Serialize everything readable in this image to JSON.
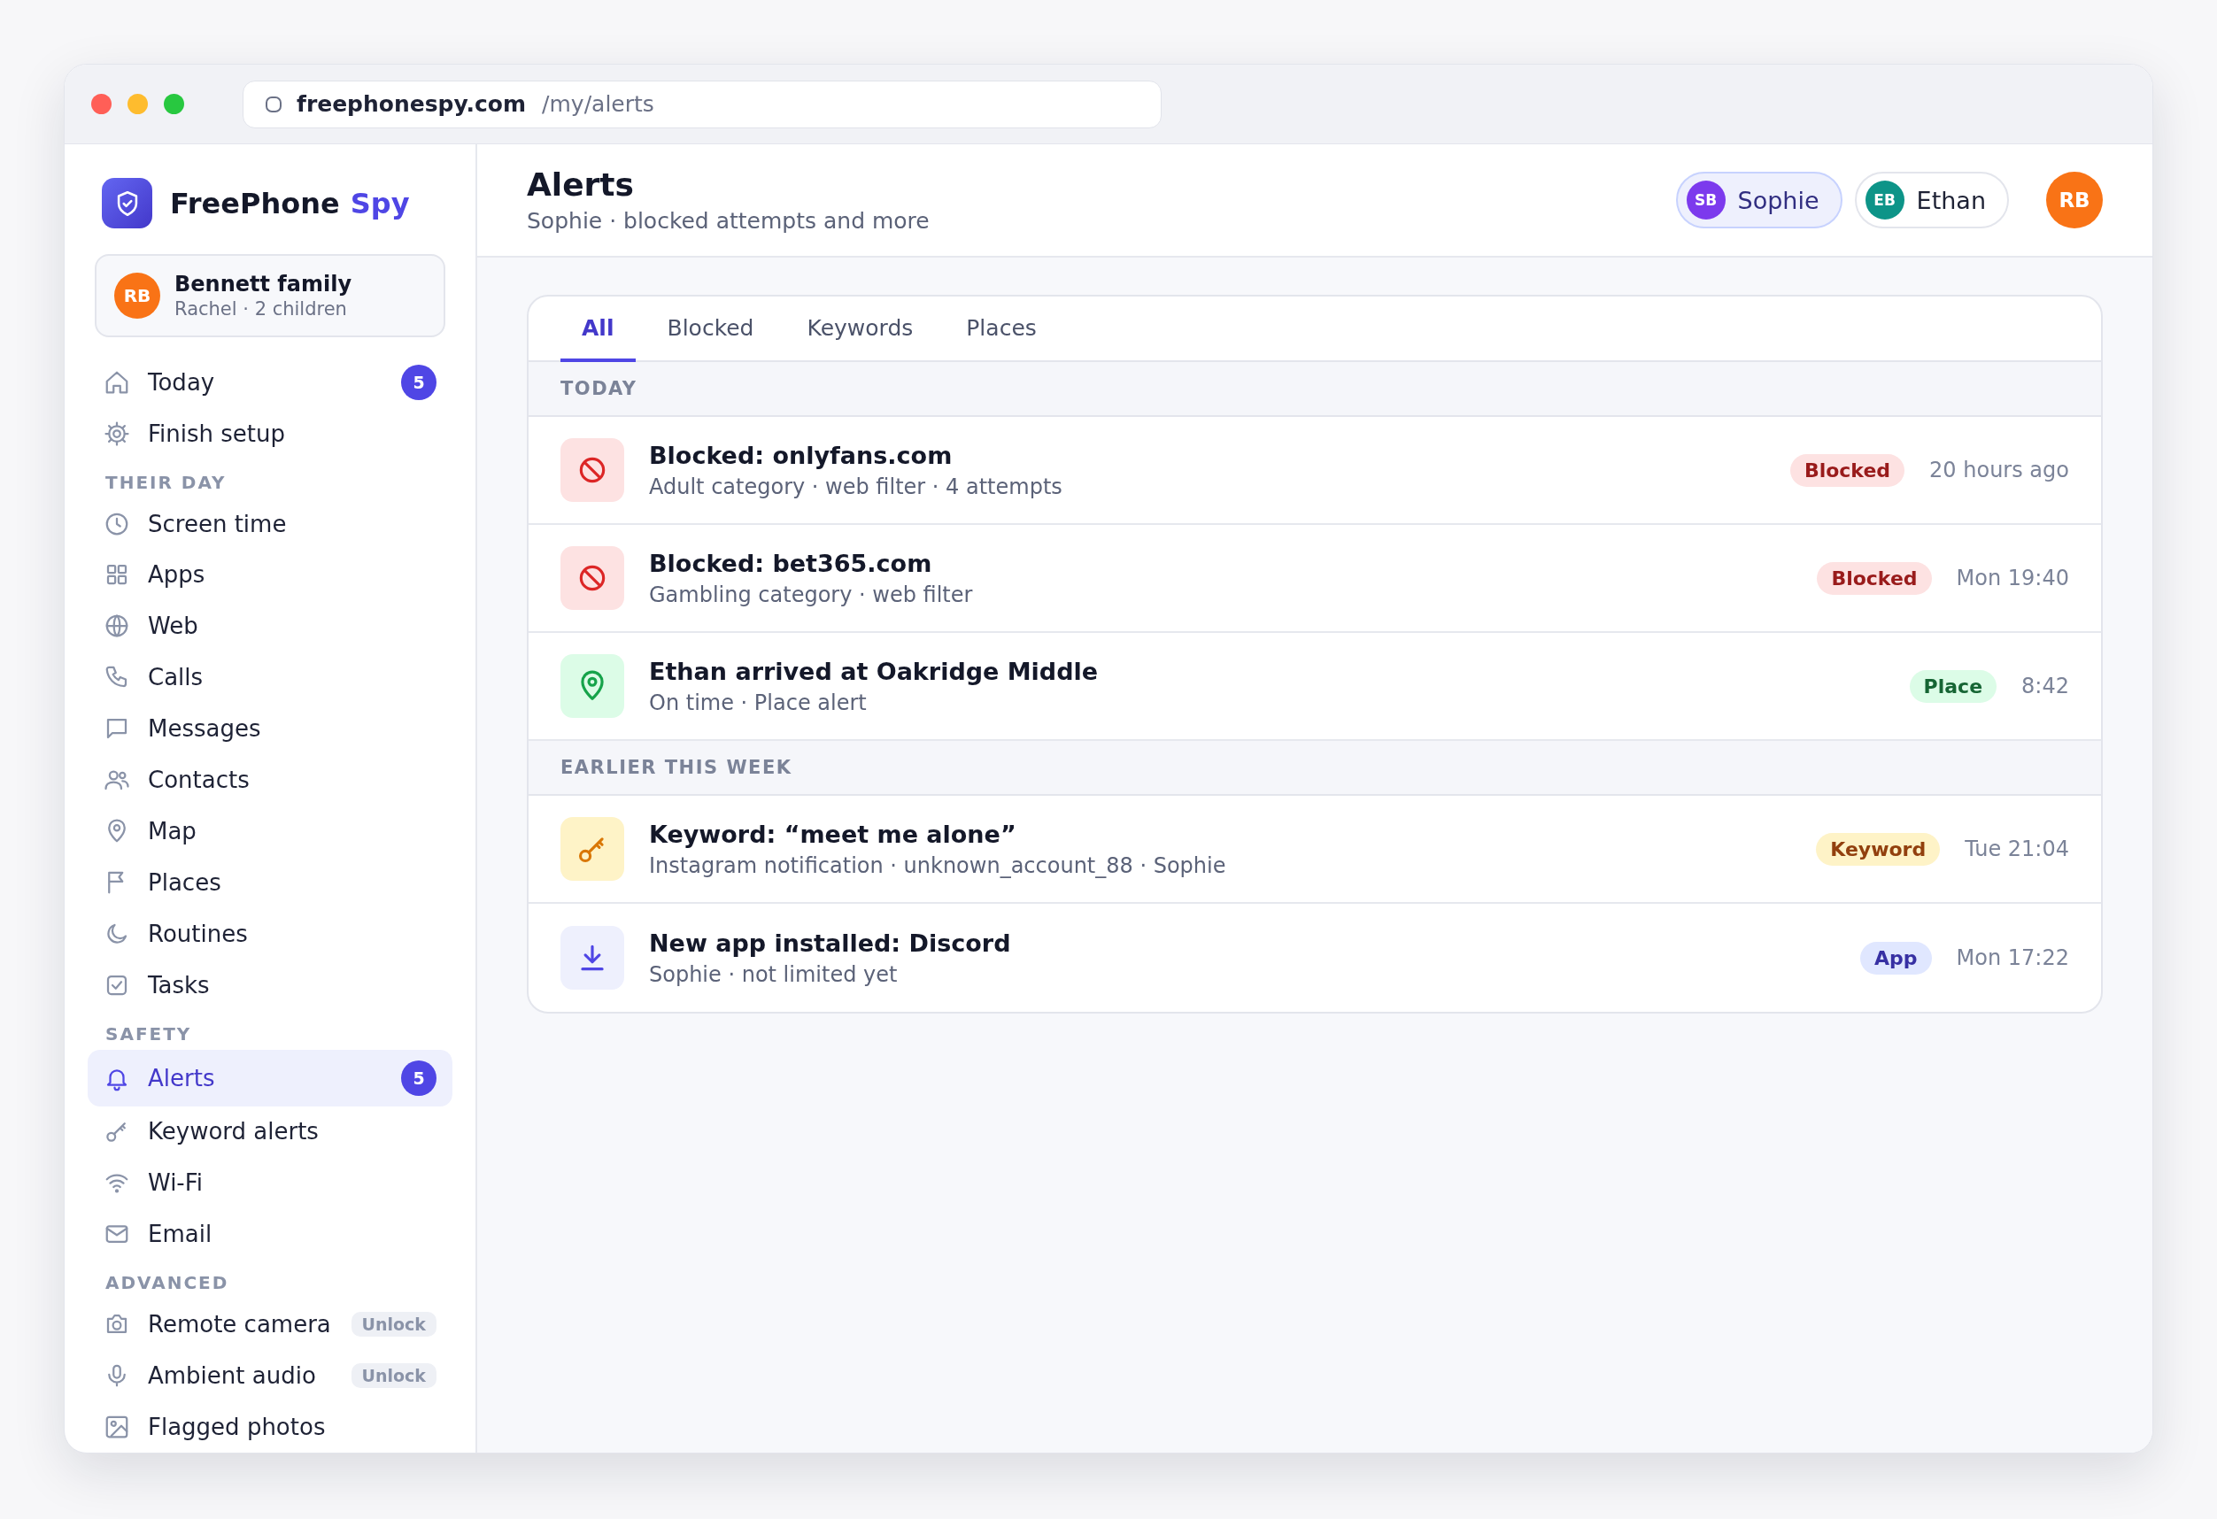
{
  "browser": {
    "domain": "freephonespy.com",
    "path": "/my/alerts"
  },
  "sidebar": {
    "brand": {
      "name": "FreePhone",
      "accent": "Spy"
    },
    "account": {
      "initials": "RB",
      "name": "Bennett family",
      "subtitle": "Rachel · 2 children",
      "color": "#f97316"
    },
    "sections": [
      {
        "items": [
          {
            "label": "Today",
            "badge": "5",
            "selected": false
          },
          {
            "label": "Finish setup",
            "selected": false
          }
        ]
      },
      {
        "title": "THEIR DAY",
        "items": [
          {
            "label": "Screen time",
            "selected": false
          },
          {
            "label": "Apps",
            "selected": false
          },
          {
            "label": "Web",
            "selected": false
          },
          {
            "label": "Calls",
            "selected": false
          },
          {
            "label": "Messages",
            "selected": false
          },
          {
            "label": "Contacts",
            "selected": false
          },
          {
            "label": "Map",
            "selected": false
          },
          {
            "label": "Places",
            "selected": false
          },
          {
            "label": "Routines",
            "selected": false
          },
          {
            "label": "Tasks",
            "selected": false
          }
        ]
      },
      {
        "title": "SAFETY",
        "items": [
          {
            "label": "Alerts",
            "badge": "5",
            "selected": true
          },
          {
            "label": "Keyword alerts",
            "selected": false
          },
          {
            "label": "Wi-Fi",
            "selected": false
          },
          {
            "label": "Email",
            "selected": false
          }
        ]
      },
      {
        "title": "ADVANCED",
        "items": [
          {
            "label": "Remote camera",
            "tag": "Unlock",
            "selected": false
          },
          {
            "label": "Ambient audio",
            "tag": "Unlock",
            "selected": false
          },
          {
            "label": "Flagged photos",
            "selected": false
          }
        ]
      }
    ]
  },
  "header": {
    "title": "Alerts",
    "subtitle": "Sophie · blocked attempts and more",
    "children": [
      {
        "initials": "SB",
        "name": "Sophie",
        "color": "#7c3aed",
        "selected": true
      },
      {
        "initials": "EB",
        "name": "Ethan",
        "color": "#0d9488",
        "selected": false
      }
    ],
    "user": {
      "initials": "RB",
      "color": "#f97316"
    }
  },
  "tabs": [
    {
      "label": "All",
      "selected": true
    },
    {
      "label": "Blocked",
      "selected": false
    },
    {
      "label": "Keywords",
      "selected": false
    },
    {
      "label": "Places",
      "selected": false
    }
  ],
  "groups": [
    {
      "heading": "TODAY",
      "alerts": [
        {
          "kind": "blocked",
          "title": "Blocked: onlyfans.com",
          "detail": "Adult category · web filter · 4 attempts",
          "tag": "Blocked",
          "time": "20 hours ago"
        },
        {
          "kind": "blocked",
          "title": "Blocked: bet365.com",
          "detail": "Gambling category · web filter",
          "tag": "Blocked",
          "time": "Mon 19:40"
        },
        {
          "kind": "place",
          "title": "Ethan arrived at Oakridge Middle",
          "detail": "On time · Place alert",
          "tag": "Place",
          "time": "8:42"
        }
      ]
    },
    {
      "heading": "EARLIER THIS WEEK",
      "alerts": [
        {
          "kind": "keyword",
          "title": "Keyword: “meet me alone”",
          "detail": "Instagram notification · unknown_account_88 · Sophie",
          "tag": "Keyword",
          "time": "Tue 21:04"
        },
        {
          "kind": "app",
          "title": "New app installed: Discord",
          "detail": "Sophie · not limited yet",
          "tag": "App",
          "time": "Mon 17:22"
        }
      ]
    }
  ]
}
